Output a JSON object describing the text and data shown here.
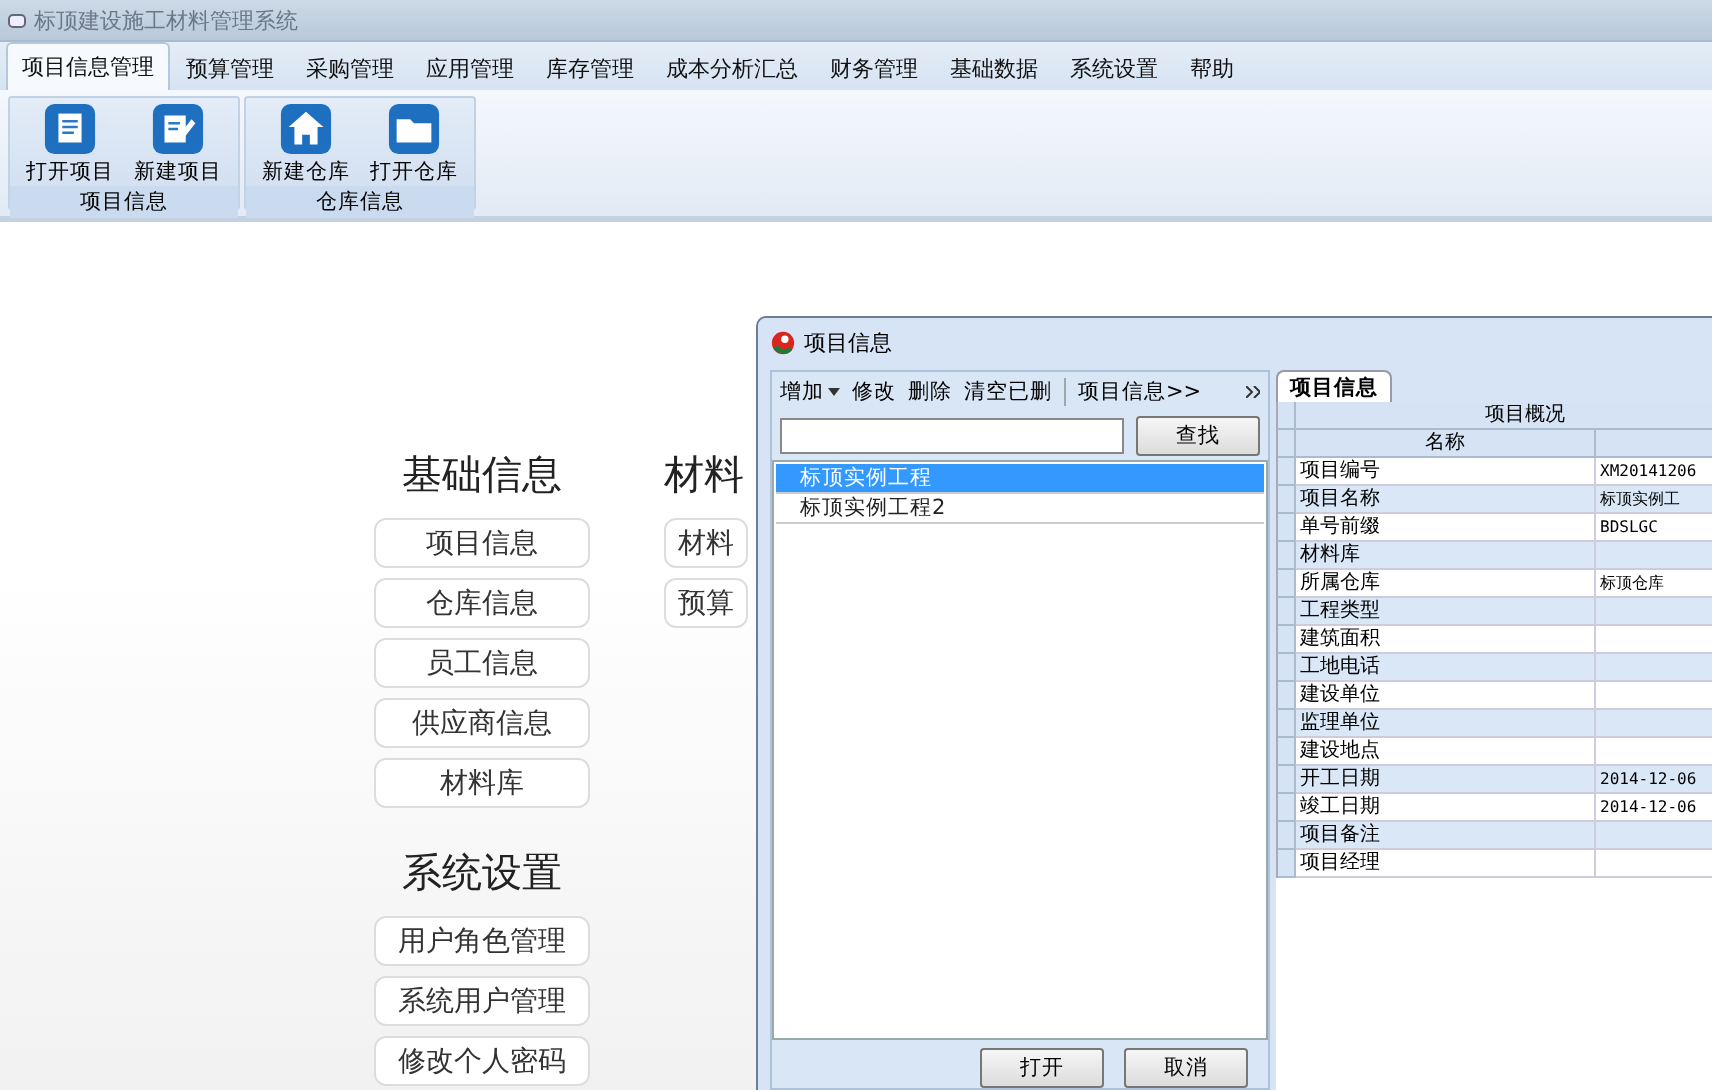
{
  "window": {
    "title": "标顶建设施工材料管理系统"
  },
  "menu_tabs": [
    {
      "label": "项目信息管理",
      "selected": true
    },
    {
      "label": "预算管理",
      "selected": false
    },
    {
      "label": "采购管理",
      "selected": false
    },
    {
      "label": "应用管理",
      "selected": false
    },
    {
      "label": "库存管理",
      "selected": false
    },
    {
      "label": "成本分析汇总",
      "selected": false
    },
    {
      "label": "财务管理",
      "selected": false
    },
    {
      "label": "基础数据",
      "selected": false
    },
    {
      "label": "系统设置",
      "selected": false
    },
    {
      "label": "帮助",
      "selected": false
    }
  ],
  "ribbon_groups": [
    {
      "label": "项目信息",
      "buttons": [
        {
          "label": "打开项目",
          "kind": "document"
        },
        {
          "label": "新建项目",
          "kind": "edit"
        }
      ]
    },
    {
      "label": "仓库信息",
      "buttons": [
        {
          "label": "新建仓库",
          "kind": "house"
        },
        {
          "label": "打开仓库",
          "kind": "folder"
        }
      ]
    }
  ],
  "sections": [
    {
      "title": "基础信息",
      "buttons": [
        "项目信息",
        "仓库信息",
        "员工信息",
        "供应商信息",
        "材料库"
      ]
    },
    {
      "title": "材料",
      "buttons": [
        "材料",
        "预算"
      ]
    },
    {
      "title": "系统设置",
      "buttons": [
        "用户角色管理",
        "系统用户管理",
        "修改个人密码"
      ]
    }
  ],
  "dialog": {
    "title": "项目信息",
    "toolbar": [
      {
        "label": "增加",
        "dropdown": true
      },
      {
        "label": "修改",
        "dropdown": false
      },
      {
        "label": "删除",
        "dropdown": false
      },
      {
        "label": "清空已删",
        "dropdown": false
      },
      {
        "label": "项目信息>>",
        "dropdown": false
      }
    ],
    "search_button": "查找",
    "list": [
      {
        "label": "标顶实例工程",
        "selected": true
      },
      {
        "label": "标顶实例工程2",
        "selected": false
      }
    ],
    "buttons": [
      "打开",
      "取消"
    ],
    "tab": "项目信息",
    "table": {
      "group_header": "项目概况",
      "column": "名称",
      "rows": [
        [
          "项目编号",
          "XM20141206"
        ],
        [
          "项目名称",
          "标顶实例工"
        ],
        [
          "单号前缀",
          "BDSLGC"
        ],
        [
          "材料库",
          ""
        ],
        [
          "所属仓库",
          "标顶仓库"
        ],
        [
          "工程类型",
          ""
        ],
        [
          "建筑面积",
          ""
        ],
        [
          "工地电话",
          ""
        ],
        [
          "建设单位",
          ""
        ],
        [
          "监理单位",
          ""
        ],
        [
          "建设地点",
          ""
        ],
        [
          "开工日期",
          "2014-12-06"
        ],
        [
          "竣工日期",
          "2014-12-06"
        ],
        [
          "项目备注",
          ""
        ],
        [
          "项目经理",
          ""
        ]
      ]
    }
  }
}
